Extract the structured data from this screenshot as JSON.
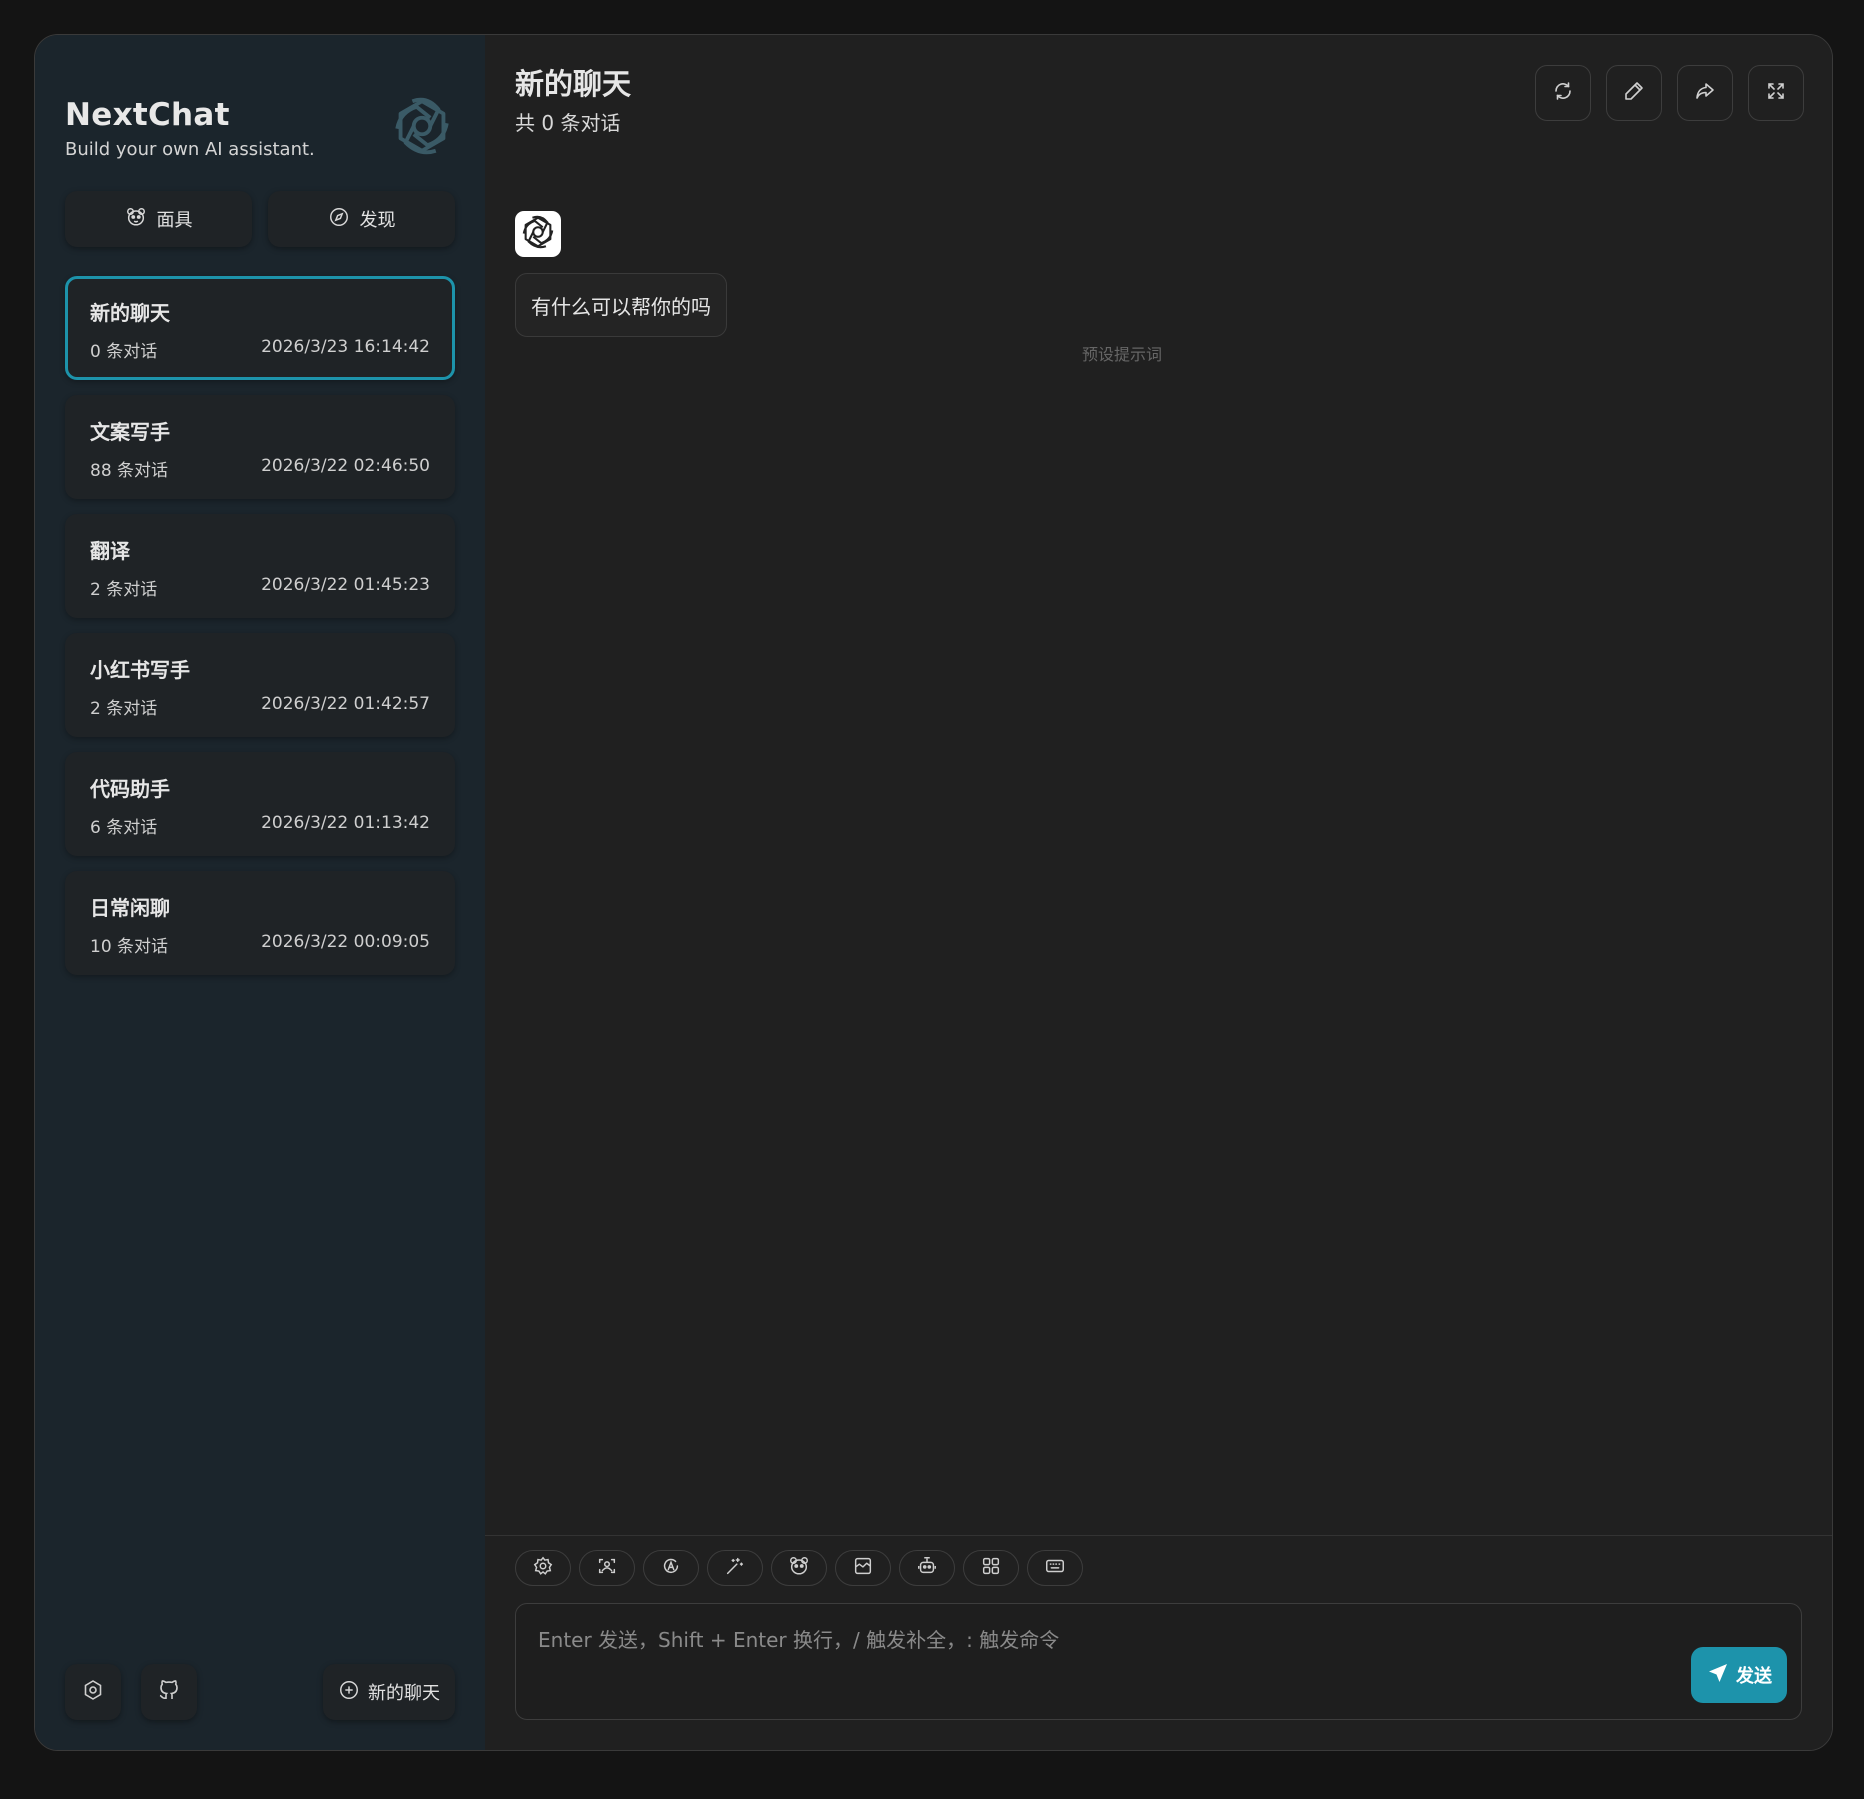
{
  "sidebar": {
    "brand_title": "NextChat",
    "brand_subtitle": "Build your own AI assistant.",
    "nav": [
      {
        "label": "面具",
        "icon": "mask-icon"
      },
      {
        "label": "发现",
        "icon": "compass-icon"
      }
    ],
    "chats": [
      {
        "title": "新的聊天",
        "count": "0 条对话",
        "time": "2026/3/23 16:14:42",
        "active": true
      },
      {
        "title": "文案写手",
        "count": "88 条对话",
        "time": "2026/3/22 02:46:50"
      },
      {
        "title": "翻译",
        "count": "2 条对话",
        "time": "2026/3/22 01:45:23"
      },
      {
        "title": "小红书写手",
        "count": "2 条对话",
        "time": "2026/3/22 01:42:57"
      },
      {
        "title": "代码助手",
        "count": "6 条对话",
        "time": "2026/3/22 01:13:42"
      },
      {
        "title": "日常闲聊",
        "count": "10 条对话",
        "time": "2026/3/22 00:09:05"
      }
    ],
    "new_chat_label": "新的聊天"
  },
  "main": {
    "title": "新的聊天",
    "subtitle": "共 0 条对话",
    "header_actions": [
      "refresh-icon",
      "edit-icon",
      "share-icon",
      "fullscreen-icon"
    ],
    "message": {
      "text": "有什么可以帮你的吗",
      "note": "预设提示词"
    },
    "toolbar": [
      "settings-icon",
      "image-icon",
      "auto-icon",
      "magic-icon",
      "mask-icon",
      "gallery-icon",
      "robot-icon",
      "grid-icon",
      "keyboard-icon"
    ],
    "input_placeholder": "Enter 发送，Shift + Enter 换行，/ 触发补全，: 触发命令",
    "send_label": "发送"
  },
  "colors": {
    "accent": "#1d93ab",
    "sidebar_bg": "#1b252c",
    "main_bg": "#202020",
    "page_bg": "#141414"
  }
}
